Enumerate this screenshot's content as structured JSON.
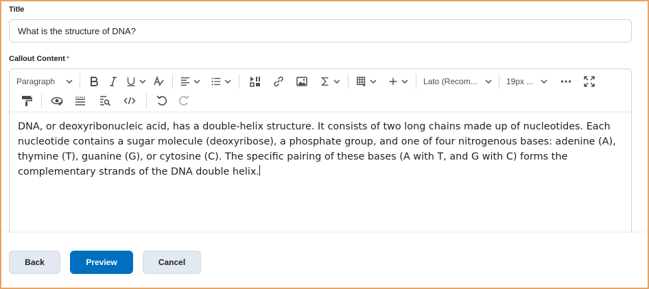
{
  "title_field": {
    "label": "Title",
    "value": "What is the structure of DNA?"
  },
  "content_field": {
    "label": "Callout Content",
    "required_marker": "*"
  },
  "toolbar": {
    "paragraph_label": "Paragraph",
    "font_label": "Lato (Recom...",
    "size_label": "19px ...",
    "icons": [
      "bold-icon",
      "italic-icon",
      "underline-icon",
      "text-style-icon",
      "align-icon",
      "list-icon",
      "insert-stuff-icon",
      "link-icon",
      "image-icon",
      "equation-icon",
      "table-icon",
      "add-icon",
      "more-icon",
      "fullscreen-icon",
      "format-painter-icon",
      "accessibility-check-icon",
      "word-count-icon",
      "find-replace-icon",
      "source-code-icon",
      "undo-icon",
      "redo-icon"
    ]
  },
  "editor": {
    "content": "DNA, or deoxyribonucleic acid, has a double-helix structure. It consists of two long chains made up of nucleotides. Each nucleotide contains a sugar molecule (deoxyribose), a phosphate group, and one of four nitrogenous bases: adenine (A), thymine (T), guanine (G), or cytosine (C). The specific pairing of these bases (A with T, and G with C) forms the complementary strands of the DNA double helix."
  },
  "buttons": {
    "back": "Back",
    "preview": "Preview",
    "cancel": "Cancel"
  },
  "colors": {
    "frame_border": "#e8a562",
    "primary": "#006fbf",
    "secondary_bg": "#e3e9f1"
  }
}
